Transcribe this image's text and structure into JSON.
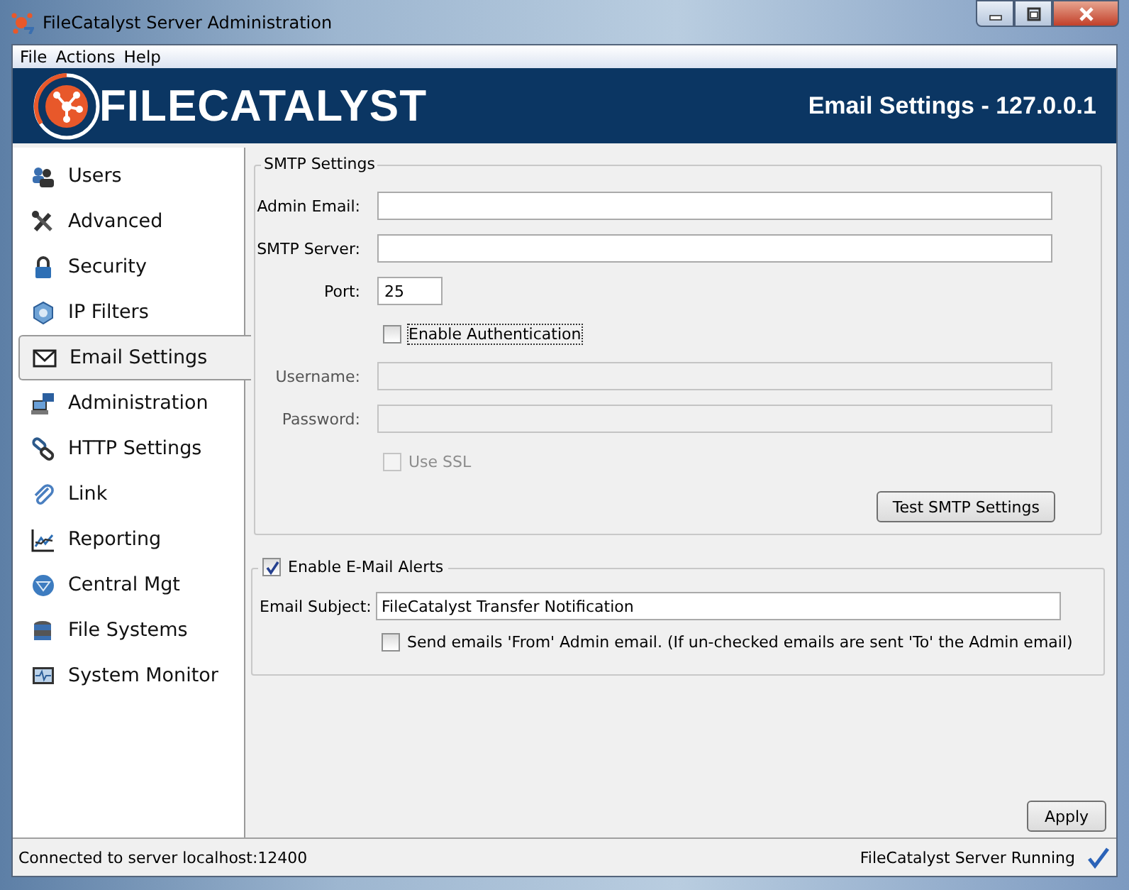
{
  "window": {
    "title": "FileCatalyst Server Administration"
  },
  "menu": [
    {
      "label": "File"
    },
    {
      "label": "Actions"
    },
    {
      "label": "Help"
    }
  ],
  "banner": {
    "logo": "FILECATALYST",
    "heading": "Email Settings - 127.0.0.1"
  },
  "sidebar": {
    "items": [
      {
        "label": "Users",
        "selected": false
      },
      {
        "label": "Advanced",
        "selected": false
      },
      {
        "label": "Security",
        "selected": false
      },
      {
        "label": "IP Filters",
        "selected": false
      },
      {
        "label": "Email Settings",
        "selected": true
      },
      {
        "label": "Administration",
        "selected": false
      },
      {
        "label": "HTTP Settings",
        "selected": false
      },
      {
        "label": "Link",
        "selected": false
      },
      {
        "label": "Reporting",
        "selected": false
      },
      {
        "label": "Central Mgt",
        "selected": false
      },
      {
        "label": "File Systems",
        "selected": false
      },
      {
        "label": "System Monitor",
        "selected": false
      }
    ]
  },
  "smtp": {
    "title": "SMTP Settings",
    "rows": [
      {
        "kind": "field",
        "label": "Admin Email:",
        "disabled": false
      },
      {
        "kind": "field",
        "label": "SMTP Server:",
        "disabled": false
      },
      {
        "kind": "short",
        "label": "Port:",
        "value": "25",
        "disabled": false
      },
      {
        "kind": "check",
        "label": "Enable Authentication",
        "checked": false,
        "disabled": false,
        "focused": true
      },
      {
        "kind": "field",
        "label": "Username:",
        "disabled": true
      },
      {
        "kind": "field",
        "label": "Password:",
        "disabled": true
      },
      {
        "kind": "check",
        "label": "Use SSL",
        "checked": false,
        "disabled": true,
        "focused": false
      }
    ],
    "button": "Test SMTP Settings"
  },
  "alerts": {
    "label": "Enable E-Mail Alerts",
    "checked": true,
    "subject_label": "Email Subject:",
    "subject_value": "FileCatalyst Transfer Notification",
    "from_option": {
      "label": "Send emails 'From' Admin email. (If un-checked emails are sent 'To' the Admin email)",
      "checked": false
    }
  },
  "apply_button": "Apply",
  "status_bar": {
    "left": "Connected to server localhost:12400",
    "right": "FileCatalyst Server Running"
  }
}
